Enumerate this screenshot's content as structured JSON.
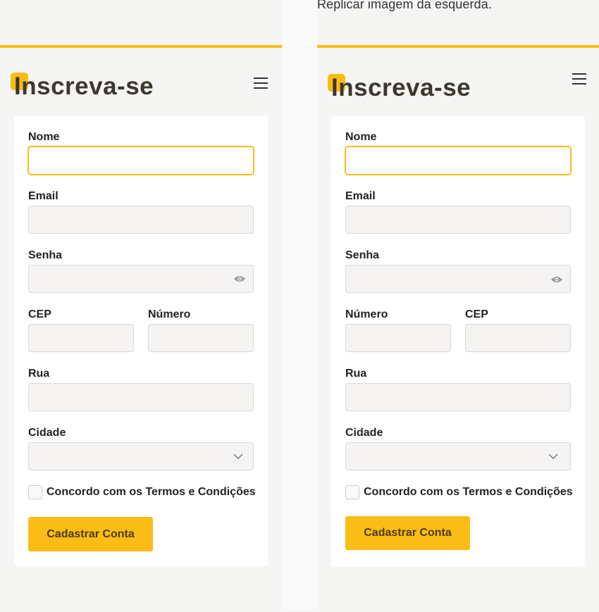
{
  "note": "Replicar imagem da esquerda.",
  "colors": {
    "accent": "#fbbc16",
    "title": "#3d382f",
    "field_bg": "#f5f4f3",
    "page_bg": "#f5f5f4"
  },
  "icons": {
    "menu": "hamburger-icon",
    "password_toggle": "eye-icon",
    "select": "chevron-down-icon"
  },
  "left": {
    "title": "Inscreva-se",
    "labels": {
      "nome": "Nome",
      "email": "Email",
      "senha": "Senha",
      "cep": "CEP",
      "numero": "Número",
      "rua": "Rua",
      "cidade": "Cidade"
    },
    "checkbox_label": "Concordo com os Termos e Condições",
    "button": "Cadastrar Conta"
  },
  "right": {
    "title": "Inscreva-se",
    "labels": {
      "nome": "Nome",
      "email": "Email",
      "senha": "Senha",
      "numero": "Número",
      "cep": "CEP",
      "rua": "Rua",
      "cidade": "Cidade"
    },
    "checkbox_label": "Concordo com os Termos e Condições",
    "button": "Cadastrar Conta"
  }
}
